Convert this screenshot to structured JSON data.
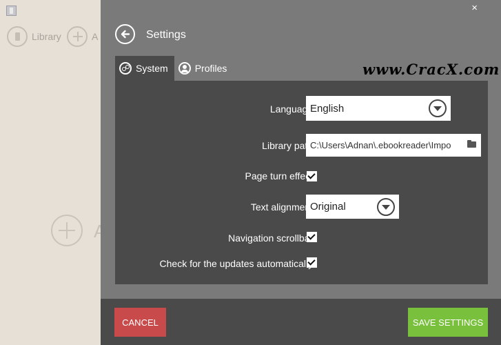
{
  "background": {
    "nav": [
      {
        "label": "Library",
        "icon": "book-icon"
      },
      {
        "label": "A",
        "icon": "plus-icon"
      }
    ],
    "big_label": "A"
  },
  "settings": {
    "title": "Settings",
    "close_glyph": "×",
    "tabs": [
      {
        "label": "System",
        "icon": "gear-icon",
        "active": true
      },
      {
        "label": "Profiles",
        "icon": "person-icon",
        "active": false
      }
    ],
    "watermark": "www.CracX.com",
    "fields": {
      "language": {
        "label": "Language:",
        "value": "English"
      },
      "library_path": {
        "label": "Library path:",
        "value": "C:\\Users\\Adnan\\.ebookreader\\Impo"
      },
      "page_turn": {
        "label": "Page turn effect:",
        "checked": true
      },
      "text_alignment": {
        "label": "Text alignment:",
        "value": "Original"
      },
      "nav_scrollbar": {
        "label": "Navigation scrollbar:",
        "checked": true
      },
      "auto_updates": {
        "label": "Check for the updates automatically:",
        "checked": true
      }
    },
    "buttons": {
      "cancel": "CANCEL",
      "save": "SAVE SETTINGS"
    }
  },
  "colors": {
    "panel": "#7a7a7a",
    "content": "#4a4a4a",
    "cancel": "#c94a4a",
    "save": "#79c03c",
    "background_app": "#e6e0d6"
  }
}
